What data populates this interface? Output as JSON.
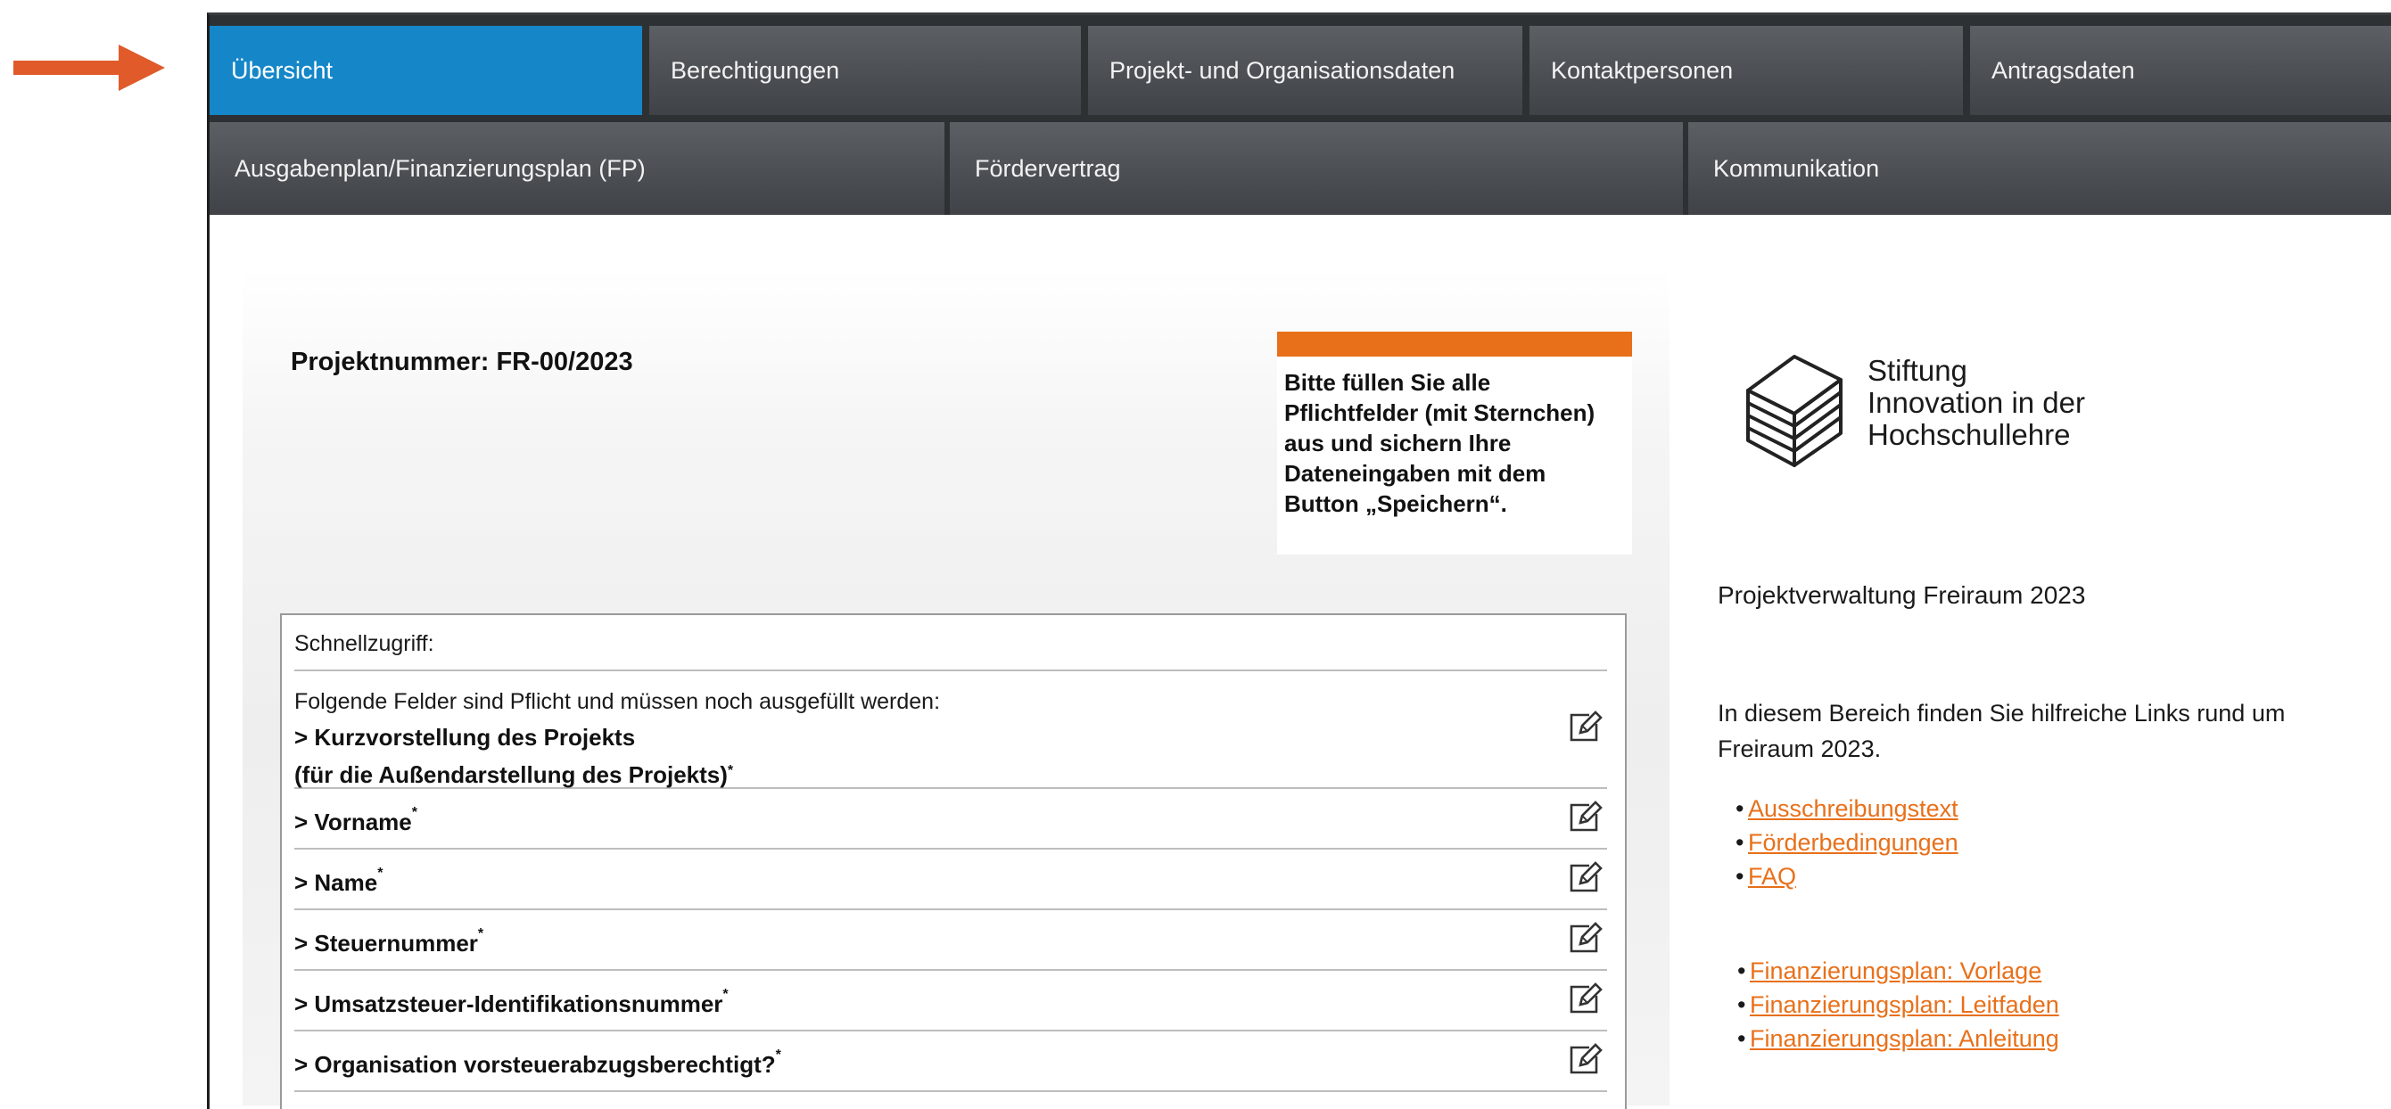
{
  "nav": {
    "row1": [
      {
        "label": "Übersicht",
        "active": true
      },
      {
        "label": "Berechtigungen"
      },
      {
        "label": "Projekt- und Organisationsdaten"
      },
      {
        "label": "Kontaktpersonen"
      },
      {
        "label": "Antragsdaten"
      }
    ],
    "row2": [
      {
        "label": "Ausgabenplan/Finanzierungsplan (FP)"
      },
      {
        "label": "Fördervertrag"
      },
      {
        "label": "Kommunikation"
      }
    ]
  },
  "project": {
    "number_label": "Projektnummer: FR-00/2023"
  },
  "notice": {
    "lines": [
      "Bitte füllen Sie alle",
      "Pflichtfelder (mit Sternchen)",
      "aus und sichern Ihre",
      "Dateneingaben mit dem",
      "Button „Speichern“."
    ]
  },
  "quick": {
    "heading": "Schnellzugriff:",
    "intro": "Folgende Felder sind Pflicht und müssen noch ausgefüllt werden:",
    "required_mark": "*",
    "items": [
      {
        "label": "> Kurzvorstellung des Projekts",
        "sublabel": "(für die Außendarstellung des Projekts)"
      },
      {
        "label": "> Vorname"
      },
      {
        "label": "> Name"
      },
      {
        "label": "> Steuernummer"
      },
      {
        "label": "> Umsatzsteuer-Identifikationsnummer"
      },
      {
        "label": "> Organisation vorsteuerabzugsberechtigt?"
      }
    ]
  },
  "brand": {
    "line1": "Stiftung",
    "line2": "Innovation in der",
    "line3": "Hochschullehre"
  },
  "sidebar": {
    "title": "Projektverwaltung Freiraum 2023",
    "info": "In diesem Bereich finden Sie hilfreiche Links rund um Freiraum 2023.",
    "links_a": [
      "Ausschreibungstext",
      "Förderbedingungen",
      "FAQ"
    ],
    "links_b": [
      "Finanzierungsplan: Vorlage",
      "Finanzierungsplan: Leitfaden",
      "Finanzierungsplan: Anleitung"
    ]
  },
  "colors": {
    "active_tab": "#1587c8",
    "accent": "#e8701a",
    "nav_bg": "#4d5155",
    "arrow": "#e05a2a"
  }
}
